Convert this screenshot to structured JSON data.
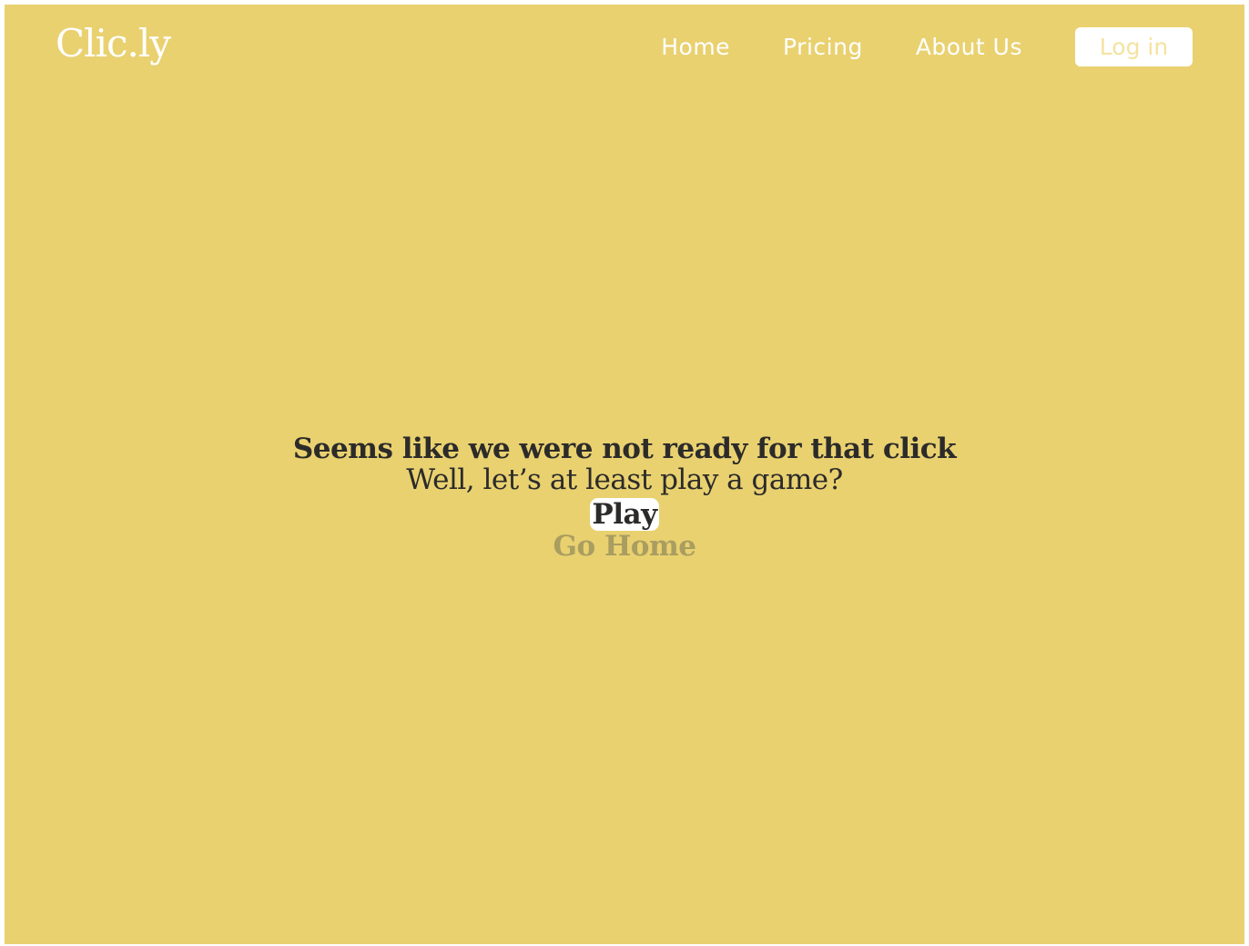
{
  "header": {
    "brand": "Clic.ly",
    "nav": [
      {
        "label": "Home"
      },
      {
        "label": "Pricing"
      },
      {
        "label": "About Us"
      }
    ],
    "login_label": "Log in"
  },
  "main": {
    "headline": "Seems like we were not ready for that click",
    "subline": "Well, let’s at least play a game?",
    "play_label": "Play",
    "go_home_label": "Go Home"
  },
  "colors": {
    "background": "#e9d170",
    "text": "#2c2b2a",
    "muted": "#a99d60",
    "white": "#ffffff"
  }
}
